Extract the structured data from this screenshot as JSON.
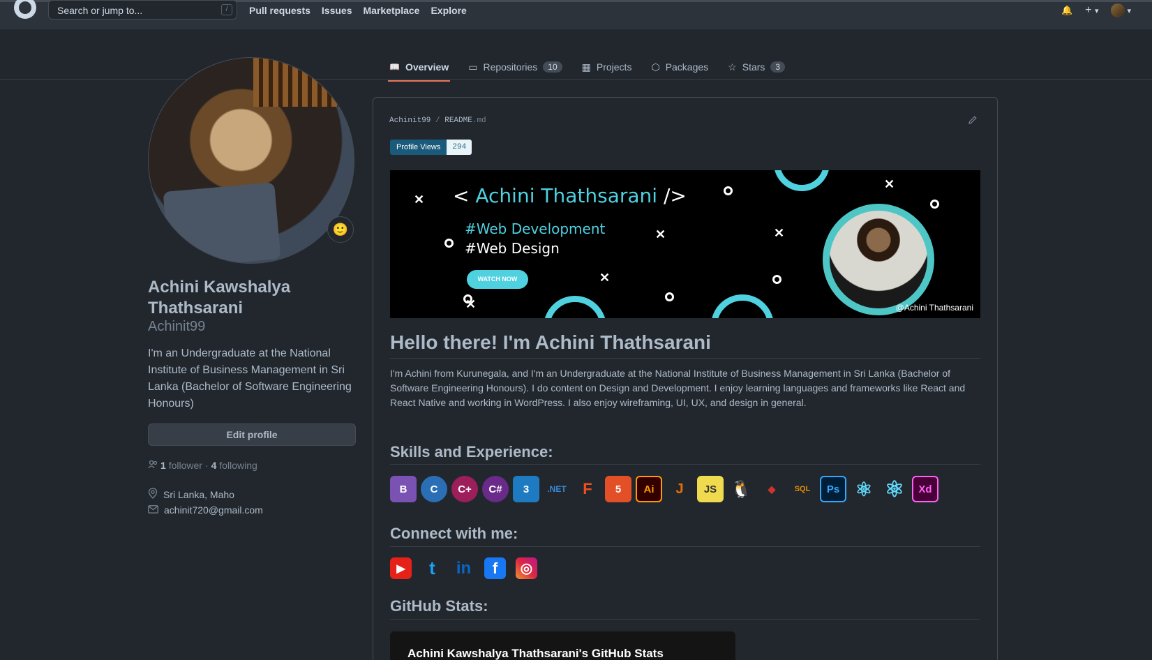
{
  "header": {
    "search_placeholder": "Search or jump to...",
    "search_key": "/",
    "nav": [
      "Pull requests",
      "Issues",
      "Marketplace",
      "Explore"
    ],
    "plus": "+",
    "caret": "▾",
    "bell": "🔔"
  },
  "tabs": [
    {
      "label": "Overview",
      "icon": "book-icon",
      "glyph": "📖",
      "count": ""
    },
    {
      "label": "Repositories",
      "icon": "repo-icon",
      "glyph": "▭",
      "count": "10"
    },
    {
      "label": "Projects",
      "icon": "project-icon",
      "glyph": "▦",
      "count": ""
    },
    {
      "label": "Packages",
      "icon": "package-icon",
      "glyph": "⬡",
      "count": ""
    },
    {
      "label": "Stars",
      "icon": "star-icon",
      "glyph": "☆",
      "count": "3"
    }
  ],
  "profile": {
    "name": "Achini Kawshalya Thathsarani",
    "login": "Achinit99",
    "status_emoji": "🙂",
    "bio": "I'm an Undergraduate at the National Institute of Business Management in Sri Lanka (Bachelor of Software Engineering Honours)",
    "edit_label": "Edit profile",
    "followers": "1",
    "followers_label": "follower",
    "sep": "·",
    "following": "4",
    "following_label": "following",
    "location": "Sri Lanka, Maho",
    "email": "achinit720@gmail.com"
  },
  "readme": {
    "user": "Achinit99",
    "slash": " / ",
    "file": "README",
    "ext": ".md",
    "badge_label": "Profile Views",
    "badge_count": "294",
    "banner": {
      "lt": "<",
      "name": "Achini Thathsarani",
      "gt": "/>",
      "line1": "#Web Development",
      "line2": "#Web Design",
      "button": "WATCH NOW",
      "credit": "@Achini Thathsarani"
    },
    "heading": "Hello there! I'm Achini Thathsarani",
    "intro": "I'm Achini from Kurunegala, and I'm an Undergraduate at the National Institute of Business Management in Sri Lanka (Bachelor of Software Engineering Honours). I do content on Design and Development. I enjoy learning languages and frameworks like React and React Native and working in WordPress. I also enjoy wireframing, UI, UX, and design in general.",
    "skills_heading": "Skills and Experience:",
    "skills": [
      {
        "name": "bootstrap-icon",
        "text": "B",
        "color": "#7952b3"
      },
      {
        "name": "c-icon",
        "text": "C",
        "color": "#2a6fb5"
      },
      {
        "name": "cplusplus-icon",
        "text": "C+",
        "color": "#9c1e5a"
      },
      {
        "name": "csharp-icon",
        "text": "C#",
        "color": "#6a2a8a"
      },
      {
        "name": "css3-icon",
        "text": "3",
        "color": "#1f7bc1"
      },
      {
        "name": "dotnet-icon",
        "text": ".NET",
        "color": "#1f4e8a"
      },
      {
        "name": "figma-icon",
        "text": "F",
        "color": "#f24e1e"
      },
      {
        "name": "html5-icon",
        "text": "5",
        "color": "#e34f26"
      },
      {
        "name": "illustrator-icon",
        "text": "Ai",
        "color": "#330000"
      },
      {
        "name": "java-icon",
        "text": "J",
        "color": "#3a6a8a"
      },
      {
        "name": "javascript-icon",
        "text": "JS",
        "color": "#f0db4f"
      },
      {
        "name": "linux-icon",
        "text": "🐧",
        "color": "#22272e"
      },
      {
        "name": "ruby-icon",
        "text": "◆",
        "color": "#22272e"
      },
      {
        "name": "mysql-icon",
        "text": "SQL",
        "color": "#22272e"
      },
      {
        "name": "photoshop-icon",
        "text": "Ps",
        "color": "#001e36"
      },
      {
        "name": "react-icon",
        "text": "⚛",
        "color": "#22272e"
      },
      {
        "name": "react-native-icon",
        "text": "⚛",
        "color": "#22272e"
      },
      {
        "name": "xd-icon",
        "text": "Xd",
        "color": "#470137"
      }
    ],
    "connect_heading": "Connect with me:",
    "socials": [
      {
        "name": "youtube-icon",
        "text": "▶",
        "color": "#e62117"
      },
      {
        "name": "twitter-icon",
        "text": "t",
        "color": "#1da1f2"
      },
      {
        "name": "linkedin-icon",
        "text": "in",
        "color": "#0a66c2"
      },
      {
        "name": "facebook-icon",
        "text": "f",
        "color": "#1877f2"
      },
      {
        "name": "instagram-icon",
        "text": "◎",
        "color": "#d6249f"
      }
    ],
    "stats_heading": "GitHub Stats:",
    "stats_card_title": "Achini Kawshalya Thathsarani's GitHub Stats"
  }
}
